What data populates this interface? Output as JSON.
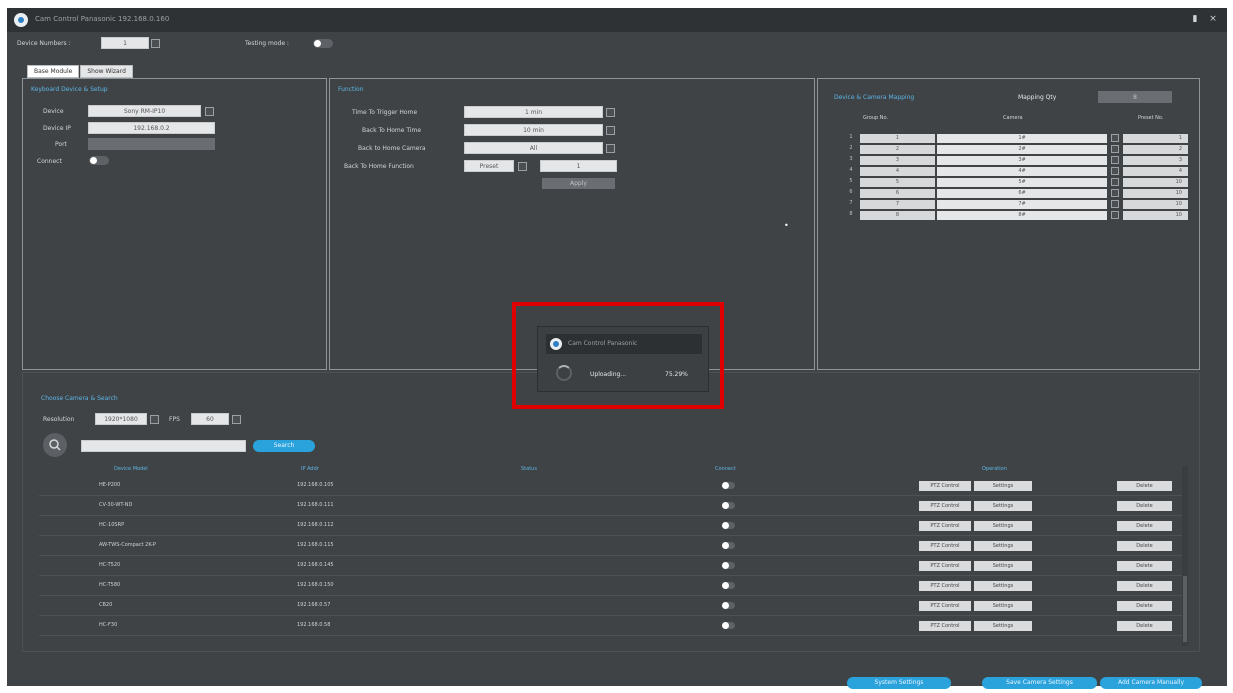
{
  "window": {
    "title": "Cam Control Panasonic 192.168.0.160",
    "pin_icon": "pin-icon",
    "close_icon": "close-icon"
  },
  "topbar": {
    "device_numbers_label": "Device Numbers :",
    "device_numbers_value": "1",
    "testing_mode_label": "Testing mode :"
  },
  "tabs": [
    "Base Module",
    "Show Wizard"
  ],
  "connect_panel": {
    "title": "Keyboard Device & Setup",
    "device_label": "Device",
    "device_value": "Sony RM-IP10",
    "device_ip_label": "Device IP",
    "device_ip_value": "192.168.0.2",
    "port_label": "Port",
    "port_value": "",
    "connect_label": "Connect"
  },
  "function_panel": {
    "title": "Function",
    "time_to_trigger_label": "Time To Trigger Home",
    "time_to_trigger_value": "1 min",
    "back_to_home_time_label": "Back To Home Time",
    "back_to_home_time_value": "10 min",
    "back_to_home_camera_label": "Back to Home Camera",
    "back_to_home_camera_value": "All",
    "back_to_home_function_label": "Back To Home Function",
    "back_to_home_function_value": "Preset",
    "back_to_home_function_extra": "1",
    "apply_label": "Apply"
  },
  "device_mapping": {
    "title": "Device & Camera Mapping",
    "mapping_qty_label": "Mapping Qty",
    "mapping_qty_value": "8",
    "columns": [
      "Group No.",
      "Camera",
      "Preset No."
    ],
    "rows": [
      {
        "idx": "1",
        "group": "1",
        "camera": "1#",
        "preset": "1"
      },
      {
        "idx": "2",
        "group": "2",
        "camera": "2#",
        "preset": "2"
      },
      {
        "idx": "3",
        "group": "3",
        "camera": "3#",
        "preset": "3"
      },
      {
        "idx": "4",
        "group": "4",
        "camera": "4#",
        "preset": "4"
      },
      {
        "idx": "5",
        "group": "5",
        "camera": "5#",
        "preset": "10"
      },
      {
        "idx": "6",
        "group": "6",
        "camera": "6#",
        "preset": "10"
      },
      {
        "idx": "7",
        "group": "7",
        "camera": "7#",
        "preset": "10"
      },
      {
        "idx": "8",
        "group": "8",
        "camera": "8#",
        "preset": "10"
      }
    ]
  },
  "camera_list": {
    "title": "Choose Camera & Search",
    "resolution_label": "Resolution",
    "resolution_value": "1920*1080",
    "fps_label": "FPS",
    "fps_value": "60",
    "search_placeholder": "",
    "search_button": "Search",
    "columns": [
      "Device Model",
      "IP Addr",
      "Status",
      "Connect",
      "Operation",
      ""
    ],
    "rows": [
      {
        "model": "HE-P200",
        "ip": "192.168.0.105",
        "status": ""
      },
      {
        "model": "CV-30-WT-ND",
        "ip": "192.168.0.111",
        "status": ""
      },
      {
        "model": "HC-10SRP",
        "ip": "192.168.0.112",
        "status": ""
      },
      {
        "model": "AW-TWS-Compact 2K-P",
        "ip": "192.168.0.115",
        "status": ""
      },
      {
        "model": "HC-T520",
        "ip": "192.168.0.145",
        "status": ""
      },
      {
        "model": "HC-T580",
        "ip": "192.168.0.150",
        "status": ""
      },
      {
        "model": "CB20",
        "ip": "192.168.0.57",
        "status": ""
      },
      {
        "model": "HC-F30",
        "ip": "192.168.0.58",
        "status": ""
      }
    ],
    "op_btn1": "PTZ Control",
    "op_btn2": "Settings",
    "delete_btn": "Delete"
  },
  "popup": {
    "title": "Cam Control Panasonic",
    "status": "Uploading...",
    "percent": "75.29%",
    "progress": 0.7529
  },
  "footer": {
    "btn1": "System Settings",
    "btn2": "Save Camera Settings",
    "btn3": "Add Camera Manually"
  },
  "colors": {
    "accent": "#2aa2dc",
    "background": "#3f4346",
    "highlight": "#e00000"
  }
}
